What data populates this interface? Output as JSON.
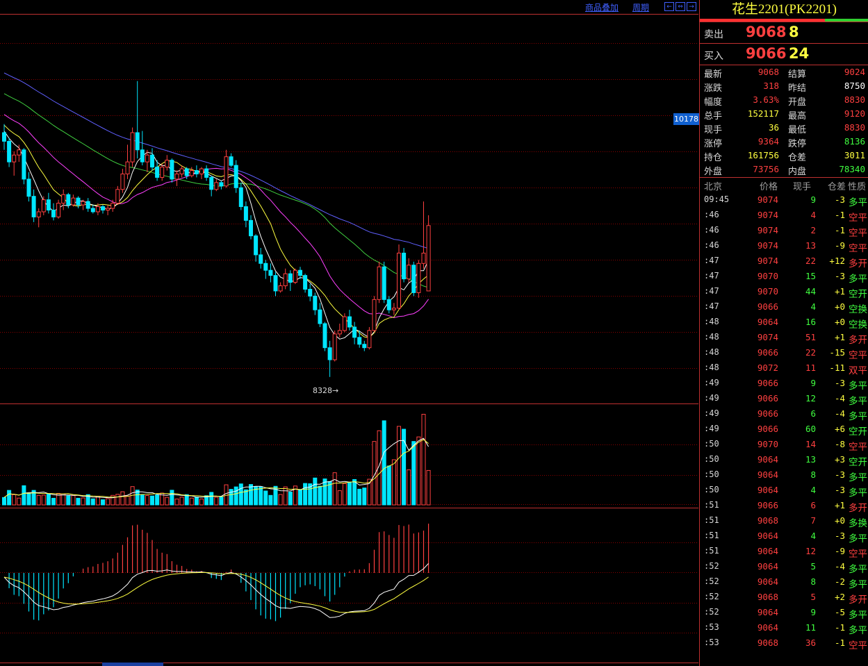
{
  "toolbar": {
    "add_product": "商品叠加",
    "period": "周期",
    "nav": [
      "←",
      "⇔",
      "→"
    ]
  },
  "chart": {
    "price_tag": "10178",
    "low_label": "8328→",
    "colors": {
      "up": "#ff4040",
      "down": "#00e6ff",
      "ma5": "#ffffff",
      "ma10": "#ffff40",
      "ma20": "#ff40ff",
      "ma40": "#40d040",
      "ma60": "#6060ff",
      "grid": "#8b0000"
    }
  },
  "chart_data": {
    "type": "candlestick",
    "candles": [
      [
        9750,
        9800,
        9650,
        9700
      ],
      [
        9700,
        9720,
        9550,
        9580
      ],
      [
        9580,
        9640,
        9500,
        9620
      ],
      [
        9620,
        9680,
        9580,
        9650
      ],
      [
        9650,
        9660,
        9450,
        9480
      ],
      [
        9480,
        9520,
        9350,
        9380
      ],
      [
        9380,
        9420,
        9230,
        9260
      ],
      [
        9260,
        9310,
        9200,
        9290
      ],
      [
        9290,
        9380,
        9270,
        9360
      ],
      [
        9360,
        9400,
        9280,
        9300
      ],
      [
        9300,
        9340,
        9240,
        9260
      ],
      [
        9260,
        9360,
        9250,
        9340
      ],
      [
        9340,
        9420,
        9300,
        9390
      ],
      [
        9390,
        9400,
        9310,
        9330
      ],
      [
        9330,
        9390,
        9320,
        9370
      ],
      [
        9370,
        9380,
        9310,
        9330
      ],
      [
        9330,
        9360,
        9300,
        9350
      ],
      [
        9350,
        9370,
        9290,
        9310
      ],
      [
        9310,
        9330,
        9280,
        9290
      ],
      [
        9290,
        9340,
        9270,
        9320
      ],
      [
        9320,
        9330,
        9280,
        9300
      ],
      [
        9300,
        9330,
        9270,
        9310
      ],
      [
        9310,
        9360,
        9290,
        9340
      ],
      [
        9340,
        9440,
        9330,
        9420
      ],
      [
        9420,
        9540,
        9400,
        9510
      ],
      [
        9510,
        9680,
        9480,
        9580
      ],
      [
        9580,
        9780,
        9550,
        9750
      ],
      [
        9750,
        10050,
        9600,
        9650
      ],
      [
        9650,
        9760,
        9560,
        9580
      ],
      [
        9580,
        9650,
        9520,
        9620
      ],
      [
        9620,
        9660,
        9530,
        9550
      ],
      [
        9550,
        9590,
        9470,
        9490
      ],
      [
        9490,
        9570,
        9470,
        9550
      ],
      [
        9550,
        9620,
        9530,
        9590
      ],
      [
        9590,
        9600,
        9460,
        9480
      ],
      [
        9480,
        9530,
        9440,
        9510
      ],
      [
        9510,
        9560,
        9490,
        9540
      ],
      [
        9540,
        9550,
        9480,
        9500
      ],
      [
        9500,
        9550,
        9490,
        9530
      ],
      [
        9530,
        9560,
        9490,
        9510
      ],
      [
        9510,
        9550,
        9480,
        9540
      ],
      [
        9540,
        9560,
        9470,
        9490
      ],
      [
        9490,
        9500,
        9380,
        9420
      ],
      [
        9420,
        9480,
        9410,
        9460
      ],
      [
        9460,
        9470,
        9420,
        9440
      ],
      [
        9440,
        9650,
        9430,
        9610
      ],
      [
        9610,
        9630,
        9550,
        9560
      ],
      [
        9560,
        9590,
        9400,
        9430
      ],
      [
        9430,
        9460,
        9300,
        9320
      ],
      [
        9320,
        9350,
        9200,
        9240
      ],
      [
        9240,
        9270,
        9130,
        9150
      ],
      [
        9150,
        9160,
        9000,
        9040
      ],
      [
        9040,
        9080,
        8960,
        8990
      ],
      [
        8990,
        9010,
        8900,
        8950
      ],
      [
        8950,
        8990,
        8880,
        8920
      ],
      [
        8920,
        8940,
        8800,
        8830
      ],
      [
        8830,
        8880,
        8820,
        8860
      ],
      [
        8860,
        8960,
        8840,
        8930
      ],
      [
        8930,
        8950,
        8830,
        8880
      ],
      [
        8880,
        8960,
        8870,
        8950
      ],
      [
        8950,
        8970,
        8900,
        8920
      ],
      [
        8920,
        8930,
        8820,
        8840
      ],
      [
        8840,
        8870,
        8770,
        8800
      ],
      [
        8800,
        8820,
        8690,
        8720
      ],
      [
        8720,
        8760,
        8620,
        8640
      ],
      [
        8640,
        8650,
        8480,
        8500
      ],
      [
        8500,
        8540,
        8330,
        8430
      ],
      [
        8430,
        8600,
        8420,
        8580
      ],
      [
        8580,
        8640,
        8560,
        8600
      ],
      [
        8600,
        8700,
        8590,
        8680
      ],
      [
        8680,
        8720,
        8600,
        8620
      ],
      [
        8620,
        8650,
        8520,
        8560
      ],
      [
        8560,
        8600,
        8500,
        8520
      ],
      [
        8520,
        8540,
        8480,
        8500
      ],
      [
        8500,
        8620,
        8490,
        8600
      ],
      [
        8600,
        8800,
        8590,
        8780
      ],
      [
        8780,
        9000,
        8760,
        8970
      ],
      [
        8970,
        9000,
        8760,
        8780
      ],
      [
        8780,
        8800,
        8700,
        8720
      ],
      [
        8720,
        8760,
        8690,
        8730
      ],
      [
        8730,
        9100,
        8720,
        9050
      ],
      [
        9050,
        9080,
        8880,
        8900
      ],
      [
        8900,
        9020,
        8880,
        8980
      ],
      [
        8980,
        9000,
        8800,
        8820
      ],
      [
        8820,
        9010,
        8790,
        8990
      ],
      [
        8990,
        9350,
        8960,
        9050
      ],
      [
        8830,
        9270,
        8830,
        9210
      ]
    ],
    "volume_max_label": "",
    "macd_note": ""
  },
  "panel": {
    "title": "花生2201(PK2201)",
    "sell": {
      "label": "卖出",
      "price": "9068",
      "vol": "8"
    },
    "buy": {
      "label": "买入",
      "price": "9066",
      "vol": "24"
    },
    "quote": [
      {
        "k1": "最新",
        "v1": "9068",
        "c1": "#ff4040",
        "k2": "结算",
        "v2": "9024",
        "c2": "#ff4040"
      },
      {
        "k1": "涨跌",
        "v1": "318",
        "c1": "#ff4040",
        "k2": "昨结",
        "v2": "8750",
        "c2": "#ffffff"
      },
      {
        "k1": "幅度",
        "v1": "3.63%",
        "c1": "#ff4040",
        "k2": "开盘",
        "v2": "8830",
        "c2": "#ff4040"
      },
      {
        "k1": "总手",
        "v1": "152117",
        "c1": "#ffff40",
        "k2": "最高",
        "v2": "9120",
        "c2": "#ff4040"
      },
      {
        "k1": "现手",
        "v1": "36",
        "c1": "#ffff40",
        "k2": "最低",
        "v2": "8830",
        "c2": "#ff4040"
      },
      {
        "k1": "涨停",
        "v1": "9364",
        "c1": "#ff4040",
        "k2": "跌停",
        "v2": "8136",
        "c2": "#40ff40"
      },
      {
        "k1": "持仓",
        "v1": "161756",
        "c1": "#ffff40",
        "k2": "仓差",
        "v2": "3011",
        "c2": "#ffff40"
      },
      {
        "k1": "外盘",
        "v1": "73756",
        "c1": "#ff4040",
        "k2": "内盘",
        "v2": "78340",
        "c2": "#40ff40"
      }
    ],
    "tick_header": {
      "time": "北京",
      "price": "价格",
      "vol": "现手",
      "oi": "仓差",
      "nature": "性质"
    },
    "ticks": [
      {
        "time": "09:45",
        "price": "9074",
        "vol": "9",
        "oi": "-3",
        "nature": "多平"
      },
      {
        "time": ":46",
        "price": "9074",
        "vol": "4",
        "oi": "-1",
        "nature": "空平"
      },
      {
        "time": ":46",
        "price": "9074",
        "vol": "2",
        "oi": "-1",
        "nature": "空平"
      },
      {
        "time": ":46",
        "price": "9074",
        "vol": "13",
        "oi": "-9",
        "nature": "空平"
      },
      {
        "time": ":47",
        "price": "9074",
        "vol": "22",
        "oi": "+12",
        "nature": "多开"
      },
      {
        "time": ":47",
        "price": "9070",
        "vol": "15",
        "oi": "-3",
        "nature": "多平"
      },
      {
        "time": ":47",
        "price": "9070",
        "vol": "44",
        "oi": "+1",
        "nature": "空开"
      },
      {
        "time": ":47",
        "price": "9066",
        "vol": "4",
        "oi": "+0",
        "nature": "空换"
      },
      {
        "time": ":48",
        "price": "9064",
        "vol": "16",
        "oi": "+0",
        "nature": "空换"
      },
      {
        "time": ":48",
        "price": "9074",
        "vol": "51",
        "oi": "+1",
        "nature": "多开"
      },
      {
        "time": ":48",
        "price": "9066",
        "vol": "22",
        "oi": "-15",
        "nature": "空平"
      },
      {
        "time": ":48",
        "price": "9072",
        "vol": "11",
        "oi": "-11",
        "nature": "双平"
      },
      {
        "time": ":49",
        "price": "9066",
        "vol": "9",
        "oi": "-3",
        "nature": "多平"
      },
      {
        "time": ":49",
        "price": "9066",
        "vol": "12",
        "oi": "-4",
        "nature": "多平"
      },
      {
        "time": ":49",
        "price": "9066",
        "vol": "6",
        "oi": "-4",
        "nature": "多平"
      },
      {
        "time": ":49",
        "price": "9066",
        "vol": "60",
        "oi": "+6",
        "nature": "空开"
      },
      {
        "time": ":50",
        "price": "9070",
        "vol": "14",
        "oi": "-8",
        "nature": "空平"
      },
      {
        "time": ":50",
        "price": "9064",
        "vol": "13",
        "oi": "+3",
        "nature": "空开"
      },
      {
        "time": ":50",
        "price": "9064",
        "vol": "8",
        "oi": "-3",
        "nature": "多平"
      },
      {
        "time": ":50",
        "price": "9064",
        "vol": "4",
        "oi": "-3",
        "nature": "多平"
      },
      {
        "time": ":51",
        "price": "9066",
        "vol": "6",
        "oi": "+1",
        "nature": "多开"
      },
      {
        "time": ":51",
        "price": "9068",
        "vol": "7",
        "oi": "+0",
        "nature": "多换"
      },
      {
        "time": ":51",
        "price": "9064",
        "vol": "4",
        "oi": "-3",
        "nature": "多平"
      },
      {
        "time": ":51",
        "price": "9064",
        "vol": "12",
        "oi": "-9",
        "nature": "空平"
      },
      {
        "time": ":52",
        "price": "9064",
        "vol": "5",
        "oi": "-4",
        "nature": "多平"
      },
      {
        "time": ":52",
        "price": "9064",
        "vol": "8",
        "oi": "-2",
        "nature": "多平"
      },
      {
        "time": ":52",
        "price": "9068",
        "vol": "5",
        "oi": "+2",
        "nature": "多开"
      },
      {
        "time": ":52",
        "price": "9064",
        "vol": "9",
        "oi": "-5",
        "nature": "多平"
      },
      {
        "time": ":53",
        "price": "9064",
        "vol": "11",
        "oi": "-1",
        "nature": "多平"
      },
      {
        "time": ":53",
        "price": "9068",
        "vol": "36",
        "oi": "-1",
        "nature": "空平"
      }
    ]
  }
}
